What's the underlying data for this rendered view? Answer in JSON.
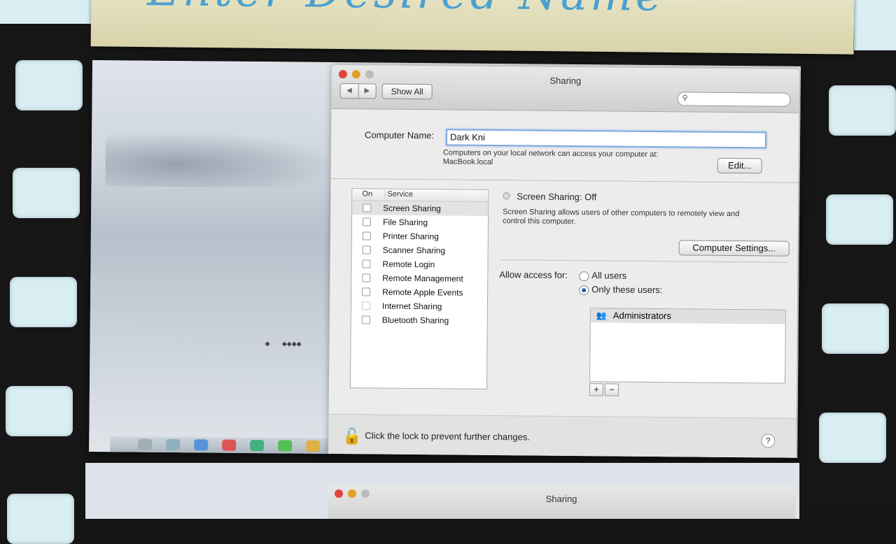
{
  "banner": {
    "text": "Enter Desired Name"
  },
  "window": {
    "title": "Sharing",
    "show_all": "Show All",
    "nav_back": "◀",
    "nav_forward": "▶",
    "search_placeholder": ""
  },
  "computer_name": {
    "label": "Computer Name:",
    "value": "Dark Kni",
    "help_line1": "Computers on your local network can access your computer at:",
    "help_line2": "MacBook.local",
    "edit_button": "Edit..."
  },
  "services": {
    "header_on": "On",
    "header_service": "Service",
    "items": [
      {
        "label": "Screen Sharing",
        "checked": false,
        "selected": true
      },
      {
        "label": "File Sharing",
        "checked": false
      },
      {
        "label": "Printer Sharing",
        "checked": false
      },
      {
        "label": "Scanner Sharing",
        "checked": false
      },
      {
        "label": "Remote Login",
        "checked": false
      },
      {
        "label": "Remote Management",
        "checked": false
      },
      {
        "label": "Remote Apple Events",
        "checked": false
      },
      {
        "label": "Internet Sharing",
        "checked": false
      },
      {
        "label": "Bluetooth Sharing",
        "checked": false
      }
    ]
  },
  "detail": {
    "status": "Screen Sharing: Off",
    "desc_line1": "Screen Sharing allows users of other computers to remotely view and",
    "desc_line2": "control this computer.",
    "computer_settings_button": "Computer Settings...",
    "allow_access_label": "Allow access for:",
    "option_all": "All users",
    "option_only": "Only these users:",
    "selected_option": "only",
    "users": [
      "Administrators"
    ],
    "add_button": "+",
    "remove_button": "−"
  },
  "footer": {
    "lock_text": "Click the lock to prevent further changes.",
    "help": "?"
  },
  "window2": {
    "title": "Sharing"
  }
}
